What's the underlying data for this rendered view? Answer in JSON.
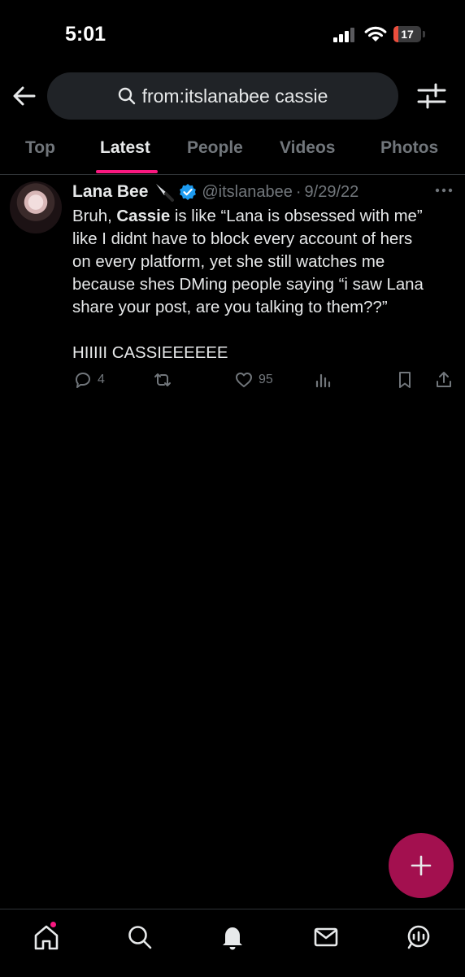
{
  "status_bar": {
    "time": "5:01",
    "battery_level": "17",
    "battery_level_fraction": 0.17,
    "battery_color": "#eb4e3d"
  },
  "header": {
    "back_icon": "arrow-left-icon",
    "search_query": "from:itslanabee cassie",
    "search_icon": "magnifier-icon",
    "filter_icon": "sliders-icon"
  },
  "tabs": [
    {
      "label": "Top",
      "active": false
    },
    {
      "label": "Latest",
      "active": true
    },
    {
      "label": "People",
      "active": false
    },
    {
      "label": "Videos",
      "active": false
    },
    {
      "label": "Photos",
      "active": false
    }
  ],
  "accent_color": "#f91880",
  "tweet": {
    "author_name": "Lana Bee",
    "author_emoji": "knife-icon",
    "verified": true,
    "handle": "@itslanabee",
    "separator": "·",
    "date": "9/29/22",
    "body_lines": [
      {
        "pre": "Bruh, ",
        "bold": "Cassie",
        "post": " is like “Lana is obsessed with me”"
      },
      {
        "text": "like I didnt have to block every account of hers"
      },
      {
        "text": "on every platform, yet she still watches me"
      },
      {
        "text": "because shes DMing people saying “i saw Lana"
      },
      {
        "text": "share your post, are you talking to them??”"
      },
      {
        "text": "HIIIII CASSIEEEEEE"
      }
    ],
    "replies": "4",
    "retweets": "",
    "likes": "95",
    "views": ""
  },
  "fab": {
    "icon": "plus-icon",
    "color": "#a3104f"
  },
  "bottom_nav": [
    {
      "name": "home-icon",
      "has_badge": true
    },
    {
      "name": "search-icon"
    },
    {
      "name": "bell-icon"
    },
    {
      "name": "mail-icon"
    },
    {
      "name": "communities-icon"
    }
  ]
}
